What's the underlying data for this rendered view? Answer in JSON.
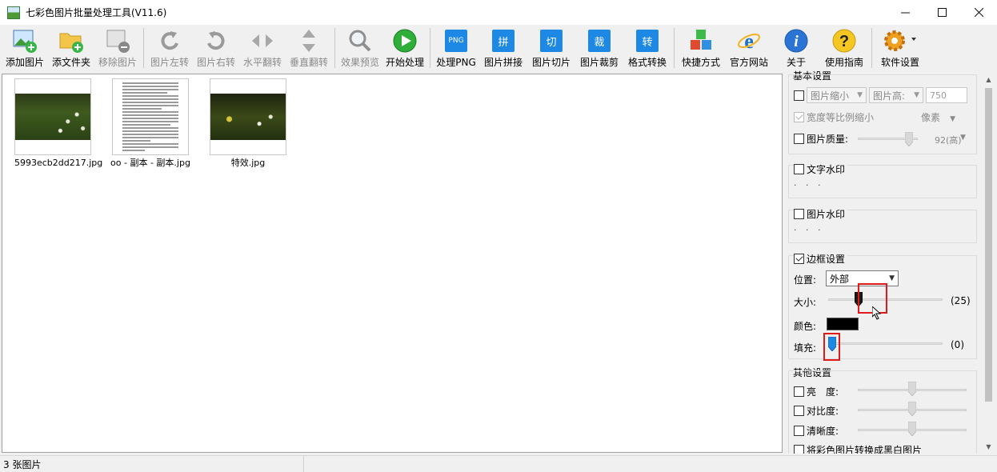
{
  "window": {
    "title": "七彩色图片批量处理工具(V11.6)"
  },
  "toolbar": {
    "add_image": "添加图片",
    "add_folder": "添文件夹",
    "remove_image": "移除图片",
    "rotate_left": "图片左转",
    "rotate_right": "图片右转",
    "flip_horizontal": "水平翻转",
    "flip_vertical": "垂直翻转",
    "preview": "效果预览",
    "start": "开始处理",
    "png": "处理PNG",
    "png_icon_text": "PNG",
    "stitch": "图片拼接",
    "stitch_icon_text": "拼",
    "slice": "图片切片",
    "slice_icon_text": "切",
    "crop": "图片裁剪",
    "crop_icon_text": "裁",
    "convert": "格式转换",
    "convert_icon_text": "转",
    "shortcut": "快捷方式",
    "website": "官方网站",
    "about": "关于",
    "guide": "使用指南",
    "settings": "软件设置"
  },
  "images": [
    {
      "name": "5993ecb2dd217.jpg",
      "kind": "photo"
    },
    {
      "name": "oo - 副本 - 副本.jpg",
      "kind": "document"
    },
    {
      "name": "特效.jpg",
      "kind": "photo-dark"
    }
  ],
  "panel": {
    "basic": {
      "title": "基本设置",
      "shrink_label": "图片缩小",
      "height_label": "图片高:",
      "height_value": "750",
      "proportional_label": "宽度等比例缩小",
      "unit": "像素",
      "quality_label": "图片质量:",
      "quality_value": "92(高)",
      "shrink_checked": false,
      "proportional_checked": true,
      "quality_checked": false
    },
    "text_watermark": {
      "label": "文字水印",
      "dots": "· · ·",
      "checked": false
    },
    "image_watermark": {
      "label": "图片水印",
      "dots": "· · ·",
      "checked": false
    },
    "border": {
      "label": "边框设置",
      "checked": true,
      "position_label": "位置:",
      "position_value": "外部",
      "size_label": "大小:",
      "size_value": "(25)",
      "size_level": 25,
      "color_label": "颜色:",
      "color": "#000000",
      "fill_label": "填充:",
      "fill_value": "(0)",
      "fill_level": 0
    },
    "other": {
      "title": "其他设置",
      "brightness": "亮　度:",
      "contrast": "对比度:",
      "sharpness": "清晰度:",
      "grayscale": "将彩色图片转换成黑白图片"
    }
  },
  "status": {
    "count": "3 张图片"
  },
  "colors": {
    "accent_blue": "#1e88e5",
    "highlight_red": "#e0191b"
  }
}
